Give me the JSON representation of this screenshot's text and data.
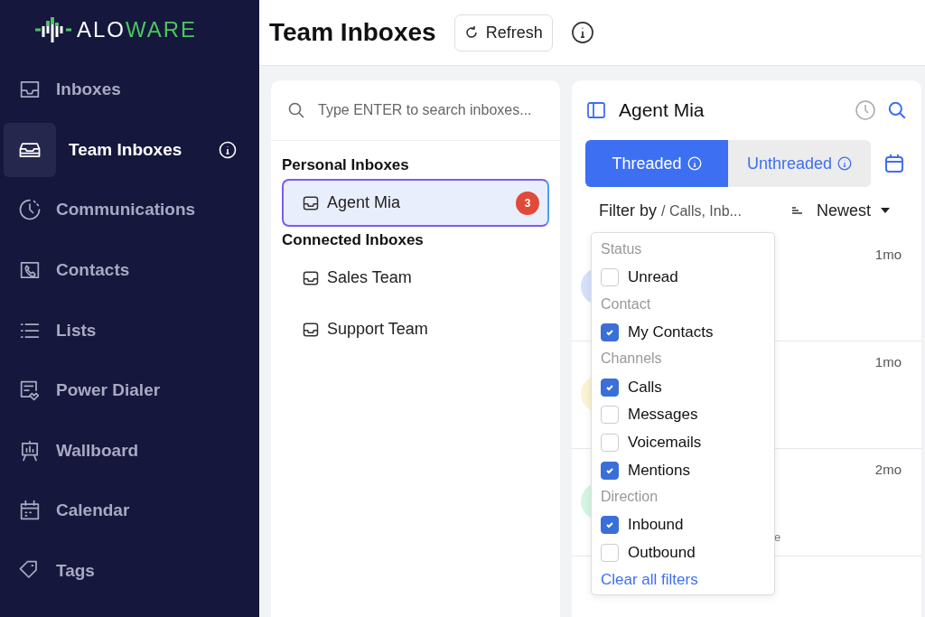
{
  "logo": [
    "ALO",
    "WARE"
  ],
  "sidebar": {
    "items": [
      {
        "label": "Inboxes",
        "kind": "inbox",
        "selected": false,
        "info": false
      },
      {
        "label": "Team Inboxes",
        "kind": "team",
        "selected": true,
        "info": true
      },
      {
        "label": "Communications",
        "kind": "clock",
        "selected": false,
        "info": false
      },
      {
        "label": "Contacts",
        "kind": "phone",
        "selected": false,
        "info": false
      },
      {
        "label": "Lists",
        "kind": "list",
        "selected": false,
        "info": false
      },
      {
        "label": "Power Dialer",
        "kind": "dialer",
        "selected": false,
        "info": false
      },
      {
        "label": "Wallboard",
        "kind": "board",
        "selected": false,
        "info": false
      },
      {
        "label": "Calendar",
        "kind": "calendar",
        "selected": false,
        "info": false
      },
      {
        "label": "Tags",
        "kind": "tag",
        "selected": false,
        "info": false
      }
    ]
  },
  "header": {
    "title": "Team Inboxes",
    "refresh_button": "Refresh"
  },
  "inbox_list": {
    "search": {
      "placeholder": "Type ENTER to search inboxes..."
    },
    "sections": [
      {
        "title": "Personal Inboxes",
        "items": [
          {
            "name": "Agent Mia",
            "selected": true,
            "badge": "3"
          }
        ]
      },
      {
        "title": "Connected Inboxes",
        "items": [
          {
            "name": "Sales Team",
            "selected": false
          },
          {
            "name": "Support Team",
            "selected": false
          }
        ]
      }
    ]
  },
  "inbox_view": {
    "title": "Agent Mia",
    "tabs": [
      {
        "label": "Threaded",
        "selected": true
      },
      {
        "label": "Unthreaded",
        "selected": false
      }
    ],
    "filter": {
      "label": "Filter by",
      "value": "/ Calls, Inb..."
    },
    "sort": "Newest",
    "rows": [
      {
        "time": "1mo",
        "color": "#d6e0fb"
      },
      {
        "time": "1mo",
        "color": "#fbf3d3"
      },
      {
        "time": "2mo",
        "color": "#d5f5e3",
        "snippet": "e"
      }
    ],
    "filter_menu": {
      "groups": [
        {
          "title": "Status",
          "options": [
            {
              "label": "Unread",
              "checked": false
            }
          ]
        },
        {
          "title": "Contact",
          "options": [
            {
              "label": "My Contacts",
              "checked": true
            }
          ]
        },
        {
          "title": "Channels",
          "options": [
            {
              "label": "Calls",
              "checked": true
            },
            {
              "label": "Messages",
              "checked": false
            },
            {
              "label": "Voicemails",
              "checked": false
            },
            {
              "label": "Mentions",
              "checked": true
            }
          ]
        },
        {
          "title": "Direction",
          "options": [
            {
              "label": "Inbound",
              "checked": true
            },
            {
              "label": "Outbound",
              "checked": false
            }
          ]
        }
      ],
      "clear_link": "Clear all filters"
    }
  }
}
